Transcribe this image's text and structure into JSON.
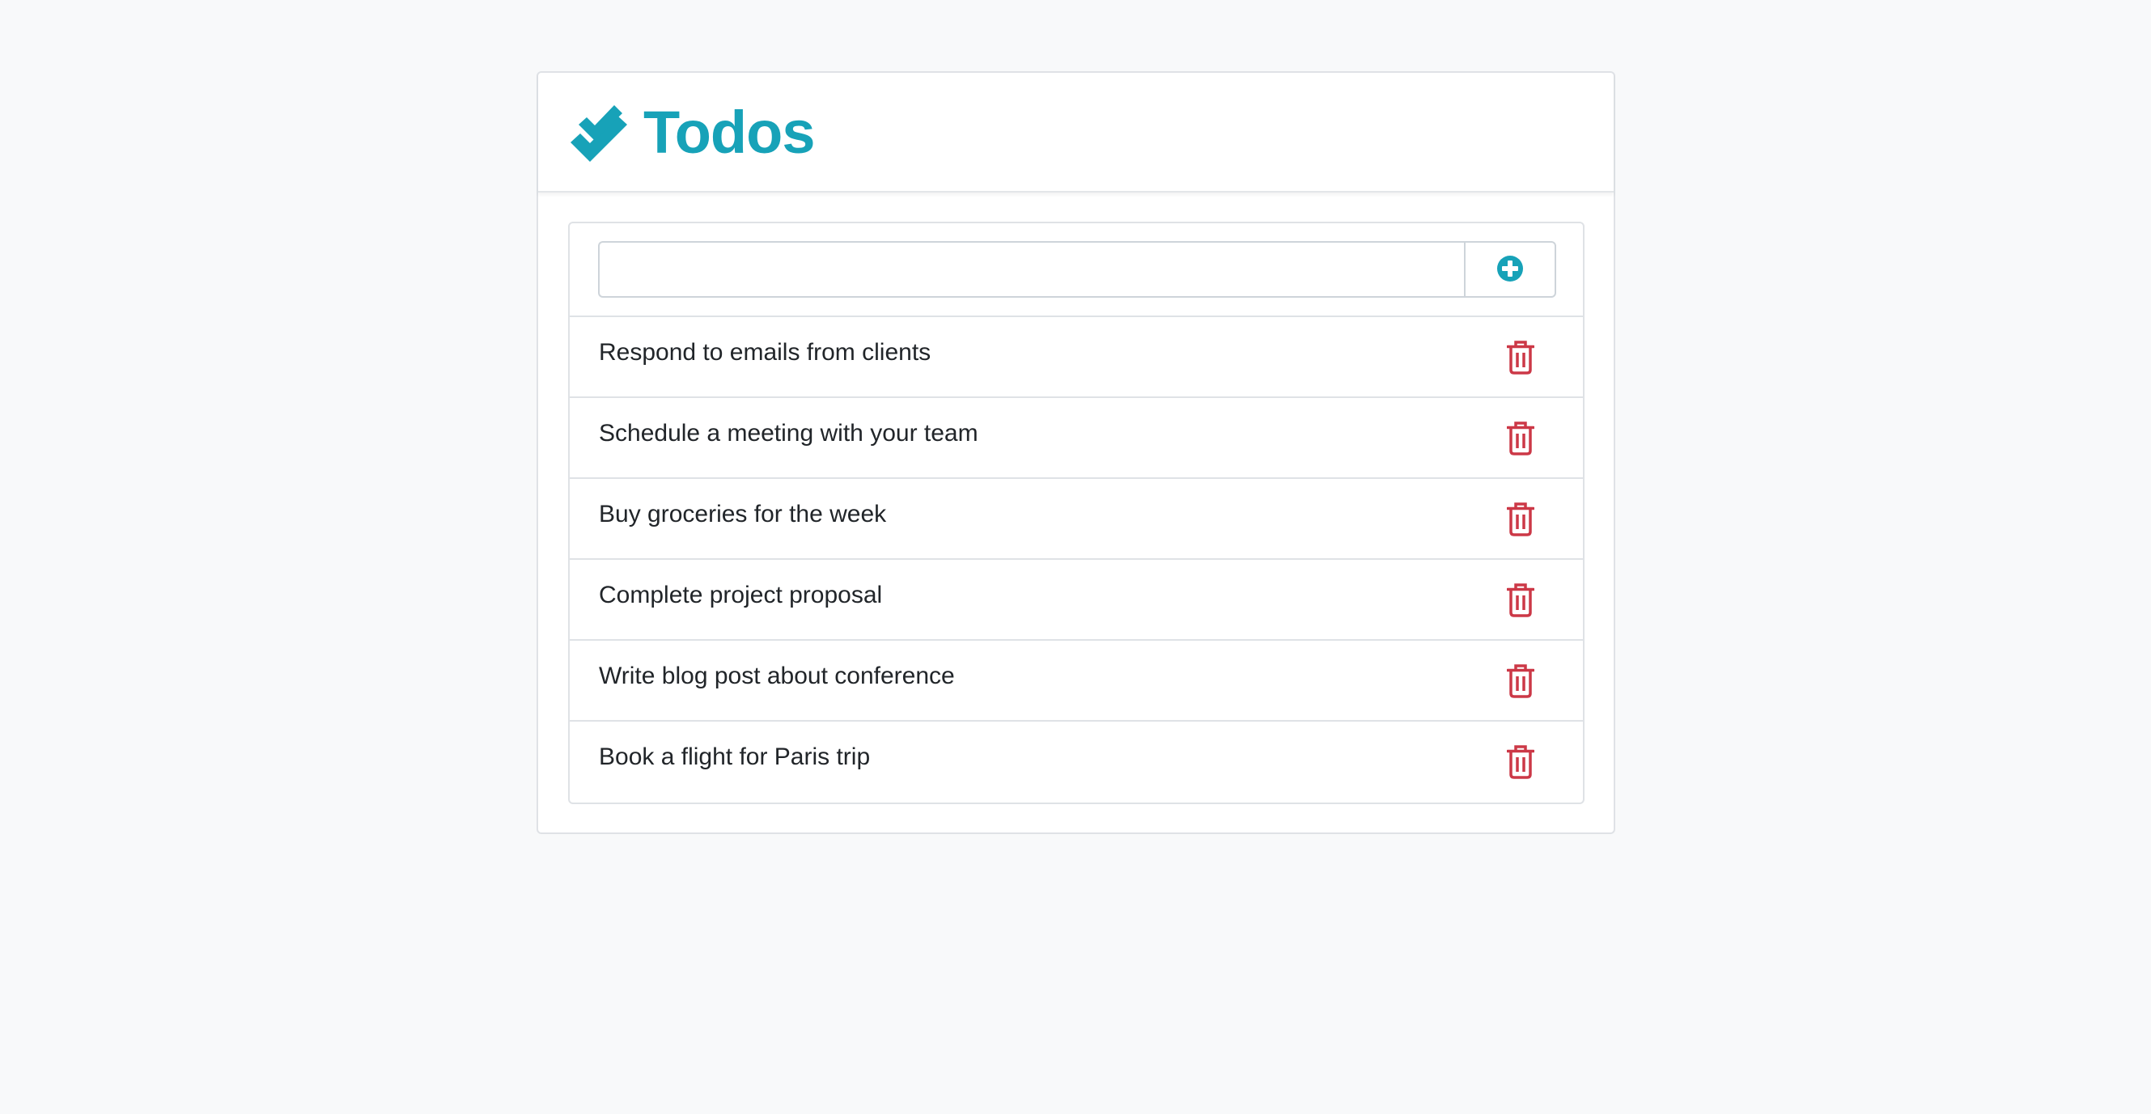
{
  "app": {
    "title": "Todos",
    "logo_icon": "double-check-icon",
    "accent_color": "#17a2b8",
    "danger_color": "#cc3847"
  },
  "add_form": {
    "input_value": "",
    "input_placeholder": "",
    "add_icon": "plus-circle-icon"
  },
  "todos": [
    {
      "text": "Respond to emails from clients",
      "delete_icon": "trash-icon"
    },
    {
      "text": "Schedule a meeting with your team",
      "delete_icon": "trash-icon"
    },
    {
      "text": "Buy groceries for the week",
      "delete_icon": "trash-icon"
    },
    {
      "text": "Complete project proposal",
      "delete_icon": "trash-icon"
    },
    {
      "text": "Write blog post about conference",
      "delete_icon": "trash-icon"
    },
    {
      "text": "Book a flight for Paris trip",
      "delete_icon": "trash-icon"
    }
  ]
}
